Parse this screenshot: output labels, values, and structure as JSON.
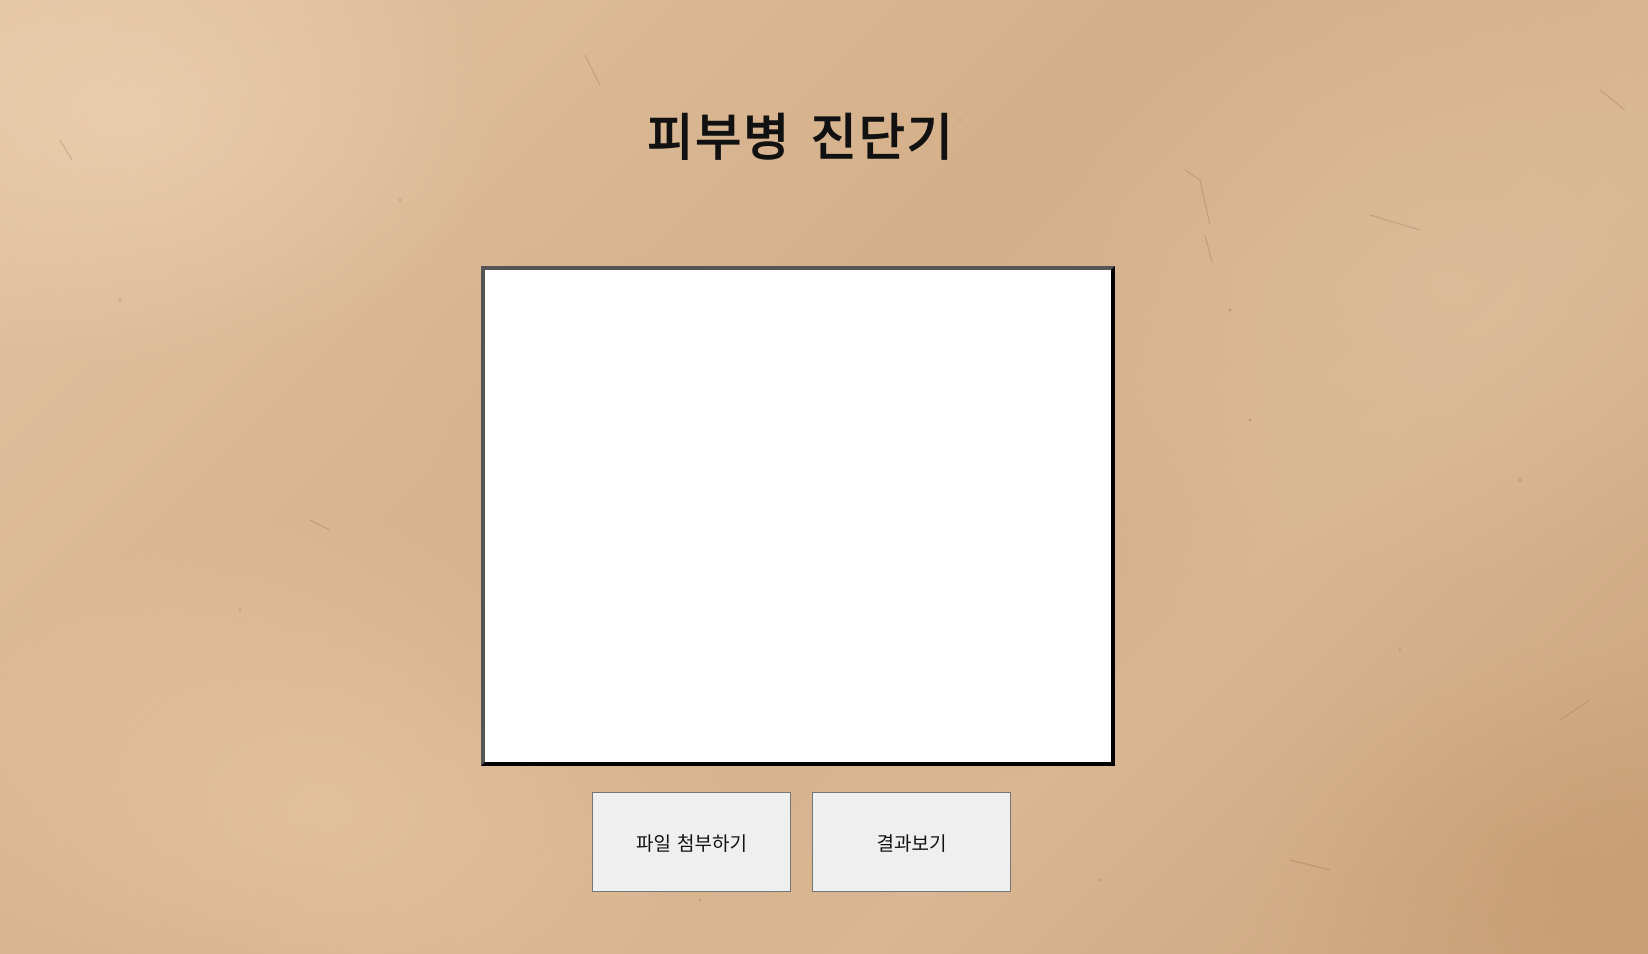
{
  "page": {
    "title": "피부병 진단기"
  },
  "preview": {
    "image": null
  },
  "buttons": {
    "attach_label": "파일 첨부하기",
    "result_label": "결과보기"
  },
  "colors": {
    "background": "#d9b894",
    "preview_bg": "#ffffff",
    "button_bg": "#efefef",
    "text": "#111111"
  }
}
